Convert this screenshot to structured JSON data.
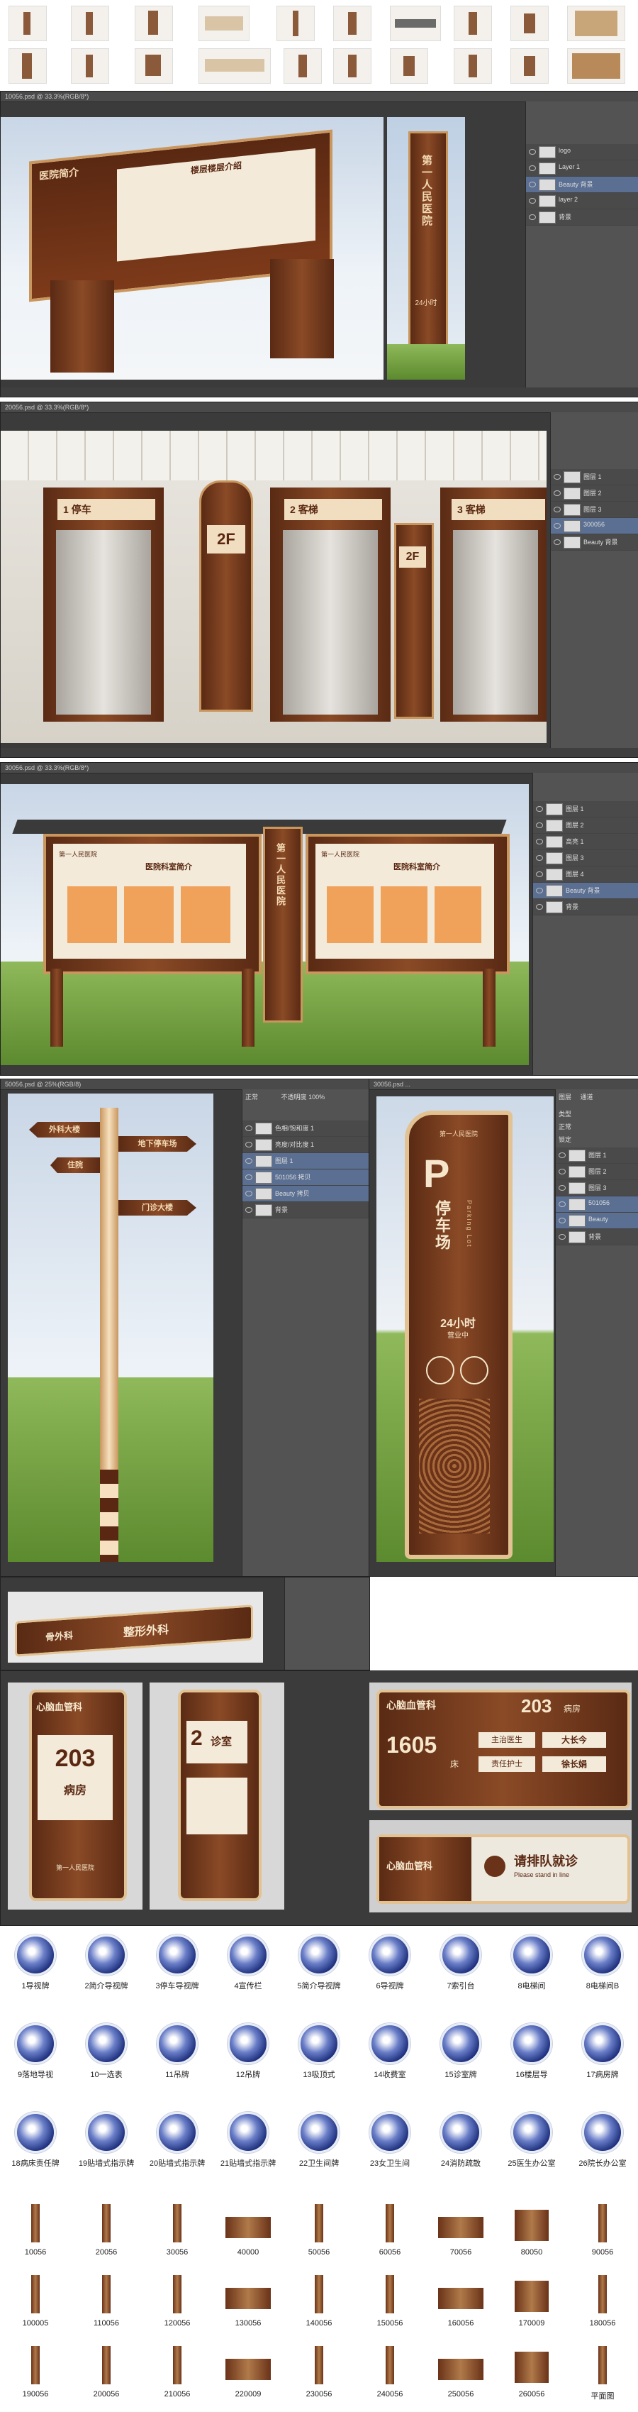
{
  "top_thumbnails": [
    "thumb-1",
    "thumb-2",
    "thumb-3",
    "thumb-4",
    "thumb-5",
    "thumb-6",
    "thumb-7",
    "thumb-8",
    "thumb-9",
    "thumb-10"
  ],
  "window1": {
    "title": "10056.psd @ 33.3%(RGB/8*)",
    "sign_header": "医院简介",
    "sign_subtitle": "楼层楼层介绍",
    "side_title": "第一人民医院",
    "side_badge": "24小时",
    "layers": [
      "logo",
      "Layer 1",
      "Beauty 背景",
      "layer 2",
      "背景"
    ]
  },
  "window2": {
    "title": "20056.psd @ 33.3%(RGB/8*)",
    "elevator_labels": [
      {
        "num": "1",
        "text": "停车"
      },
      {
        "num": "2",
        "text": "客梯"
      },
      {
        "num": "3",
        "text": "客梯"
      }
    ],
    "floor_mark": "2F",
    "layers": [
      "图层 1",
      "图层 2",
      "图层 3",
      "300056",
      "Beauty 背景"
    ]
  },
  "window3": {
    "title": "30056.psd @ 33.3%(RGB/8*)",
    "board_title_left": "医院科室简介",
    "board_title_right": "医院科室简介",
    "logo_text": "第一人民医院",
    "center_text": "第一人民医院",
    "layers": [
      "图层 1",
      "图层 2",
      "高亮 1",
      "图层 3",
      "图层 4",
      "Beauty 背景",
      "背景"
    ]
  },
  "window4": {
    "title": "50056.psd @ 25%(RGB/8)",
    "arrows": [
      "外科大楼",
      "地下停车场",
      "住院",
      "门诊大楼"
    ],
    "layers_mode": "正常",
    "opacity_label": "不透明度",
    "opacity_value": "100%",
    "layers": [
      "色相/饱和度 1",
      "亮度/对比度 1",
      "图层 1",
      "501056 拷贝",
      "Beauty 拷贝",
      "背景"
    ]
  },
  "window5": {
    "title": "30056.psd ...",
    "logo_text": "第一人民医院",
    "letter": "P",
    "text": "停车场",
    "small": "Parking Lot",
    "badge": "24小时",
    "badge_small": "营业中",
    "panel_tabs": [
      "图层",
      "通道"
    ],
    "layer_kind": "类型",
    "mode": "正常",
    "lock_label": "锁定",
    "layers": [
      "图层 1",
      "图层 2",
      "图层 3",
      "501056",
      "Beauty",
      "背景"
    ]
  },
  "window6": {
    "text": "整形外科",
    "label": "骨外科"
  },
  "window7": {
    "left_header": "心脑血管科",
    "room_number": "203",
    "room_label": "病房",
    "logo_small": "第一人民医院",
    "mid_number": "2",
    "mid_label": "诊室",
    "right_header": "心脑血管科",
    "right_room": "203",
    "right_room_label": "病房",
    "right_big": "1605",
    "right_big_label": "床",
    "doctor_labels": [
      "主治医生",
      "责任护士"
    ],
    "doctor_names": [
      "大长今",
      "徐长娟"
    ],
    "queue_header": "心脑血管科",
    "queue_text": "请排队就诊",
    "queue_small": "Please stand in line"
  },
  "files": [
    "1导视牌",
    "2简介导视牌",
    "3停车导视牌",
    "4宣传栏",
    "5简介导视牌",
    "6导视牌",
    "7索引台",
    "8电梯间",
    "8电梯间B",
    "9落地导视",
    "10一选表",
    "11吊牌",
    "12吊牌",
    "13吸顶式",
    "14收费室",
    "15诊室牌",
    "16楼层导",
    "17病房牌",
    "18病床责任牌",
    "19贴墙式指示牌",
    "20贴墙式指示牌",
    "21贴墙式指示牌",
    "22卫生间牌",
    "23女卫生间",
    "24消防疏散",
    "25医生办公室",
    "26院长办公室"
  ],
  "thumb_files": [
    "10056",
    "20056",
    "30056",
    "40000",
    "50056",
    "60056",
    "70056",
    "80050",
    "90056",
    "100005",
    "110056",
    "120056",
    "130056",
    "140056",
    "150056",
    "160056",
    "170009",
    "180056",
    "190056",
    "200056",
    "210056",
    "220009",
    "230056",
    "240056",
    "250056",
    "260056",
    "平面图"
  ]
}
